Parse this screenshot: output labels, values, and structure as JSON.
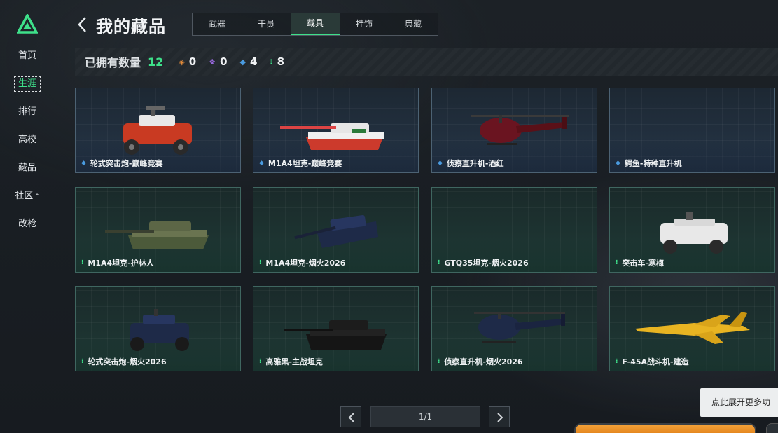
{
  "sidebar": {
    "items": [
      {
        "label": "首页"
      },
      {
        "label": "生涯"
      },
      {
        "label": "排行"
      },
      {
        "label": "高校"
      },
      {
        "label": "藏品"
      },
      {
        "label": "社区",
        "caret": "^"
      },
      {
        "label": "改枪"
      }
    ],
    "active": "生涯",
    "accent": "#3ee08a"
  },
  "header": {
    "title": "我的藏品",
    "back_icon": "chevron-left-icon"
  },
  "tabs": [
    {
      "label": "武器"
    },
    {
      "label": "干员"
    },
    {
      "label": "载具",
      "active": true
    },
    {
      "label": "挂饰"
    },
    {
      "label": "典藏"
    }
  ],
  "stats": {
    "owned_label": "已拥有数量",
    "owned_count": "12",
    "rarities": [
      {
        "icon": "orange-diamond-icon",
        "color": "#e08a3a",
        "count": "0"
      },
      {
        "icon": "purple-diamond-icon",
        "color": "#9a6ae0",
        "count": "0"
      },
      {
        "icon": "blue-diamond-icon",
        "color": "#4a9be0",
        "count": "4"
      },
      {
        "icon": "green-diamond-icon",
        "color": "#3ee08a",
        "count": "8"
      }
    ]
  },
  "items": [
    {
      "name": "轮式突击炮-巅峰竞赛",
      "rarity": "blue"
    },
    {
      "name": "M1A4坦克-巅峰竞赛",
      "rarity": "blue"
    },
    {
      "name": "侦察直升机-酒红",
      "rarity": "blue"
    },
    {
      "name": "鳄鱼-特种直升机",
      "rarity": "blue"
    },
    {
      "name": "M1A4坦克-护林人",
      "rarity": "green"
    },
    {
      "name": "M1A4坦克-烟火2026",
      "rarity": "green"
    },
    {
      "name": "GTQ35坦克-烟火2026",
      "rarity": "green"
    },
    {
      "name": "突击车-寒梅",
      "rarity": "green"
    },
    {
      "name": "轮式突击炮-烟火2026",
      "rarity": "green"
    },
    {
      "name": "高雅黑-主战坦克",
      "rarity": "green"
    },
    {
      "name": "侦察直升机-烟火2026",
      "rarity": "green"
    },
    {
      "name": "F-45A战斗机-建造",
      "rarity": "green"
    }
  ],
  "pagination": {
    "label": "1/1"
  },
  "tooltip": {
    "text": "点此展开更多功"
  }
}
